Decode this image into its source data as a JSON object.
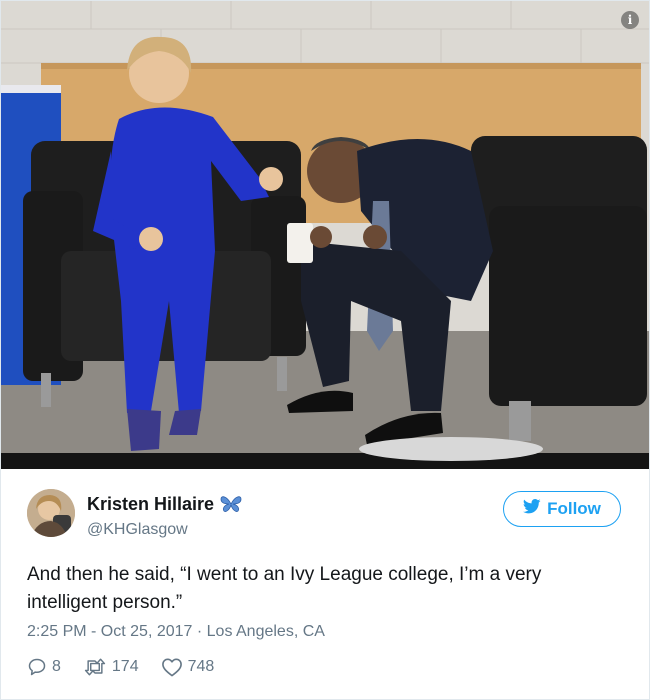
{
  "photo": {
    "info_icon": "info-icon",
    "info_glyph": "i"
  },
  "author": {
    "display_name": "Kristen Hillaire",
    "handle": "@KHGlasgow",
    "badge_icon": "butterfly-icon",
    "follow_label": "Follow"
  },
  "tweet": {
    "text": "And then he said, “I went to an Ivy League college, I’m a very intelligent person.”",
    "timestamp": "2:25 PM - Oct 25, 2017 · Los Angeles, CA",
    "replies": "8",
    "retweets": "174",
    "likes": "748"
  },
  "colors": {
    "accent": "#1da1f2",
    "muted": "#657786",
    "text": "#14171a"
  }
}
